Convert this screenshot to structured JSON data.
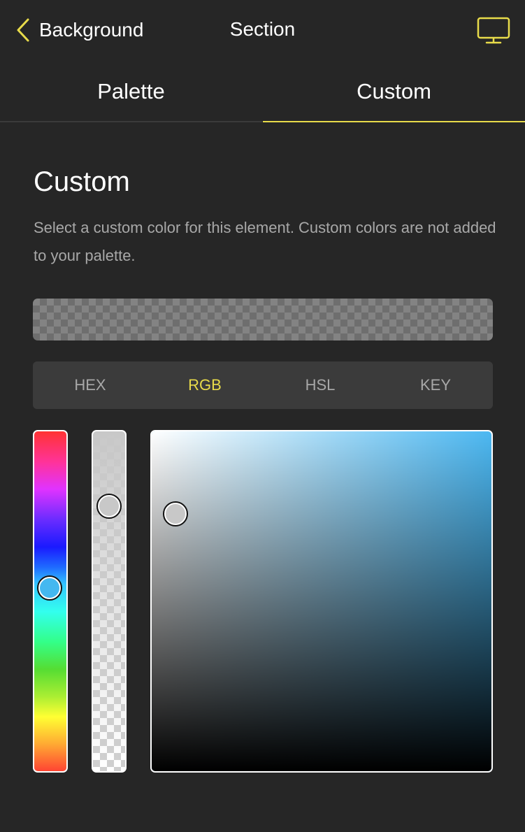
{
  "header": {
    "back_label": "Background",
    "title": "Section",
    "back_icon": "chevron-left-icon",
    "device_icon": "desktop-monitor-icon"
  },
  "tabs": [
    {
      "label": "Palette",
      "active": false
    },
    {
      "label": "Custom",
      "active": true
    }
  ],
  "section": {
    "title": "Custom",
    "description": "Select a custom color for this element. Custom colors are not added to your palette."
  },
  "color_modes": [
    {
      "label": "HEX",
      "active": false
    },
    {
      "label": "RGB",
      "active": true
    },
    {
      "label": "HSL",
      "active": false
    },
    {
      "label": "KEY",
      "active": false
    }
  ],
  "picker": {
    "hue_color": "#44b8f0",
    "selected_color": "#c8c8c8"
  },
  "colors": {
    "background": "#262626",
    "accent": "#e8db4a",
    "muted_text": "#a8a8a8",
    "segment_bg": "#3b3b3b"
  }
}
